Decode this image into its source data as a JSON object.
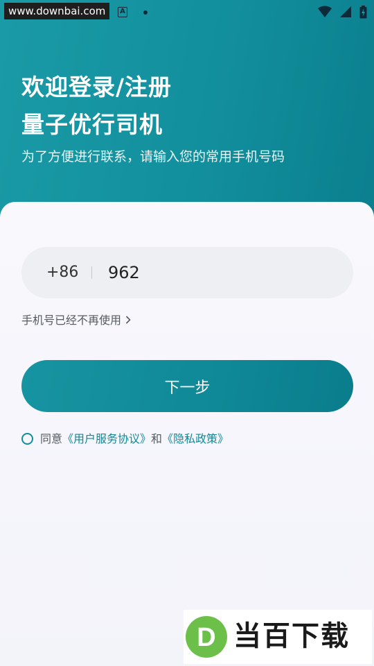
{
  "status_bar": {
    "watermark": "www.downbai.com",
    "notification_badge": "A",
    "icons": [
      "wifi-icon",
      "signal-icon",
      "battery-charging-icon"
    ]
  },
  "header": {
    "title_line1": "欢迎登录/注册",
    "title_line2": "量子优行司机",
    "subtitle": "为了方便进行联系，请输入您的常用手机号码"
  },
  "form": {
    "country_code": "+86",
    "phone_value": "962",
    "no_longer_used": "手机号已经不再使用",
    "next_label": "下一步"
  },
  "agreement": {
    "prefix": "同意",
    "user_agreement": "《用户服务协议》",
    "conjunction": "和",
    "privacy_policy": "《隐私政策》"
  },
  "watermark_bottom": {
    "logo_letter": "D",
    "text": "当百下载"
  },
  "colors": {
    "primary": "#128f9d",
    "link": "#128896",
    "background": "#f6f6fb"
  }
}
